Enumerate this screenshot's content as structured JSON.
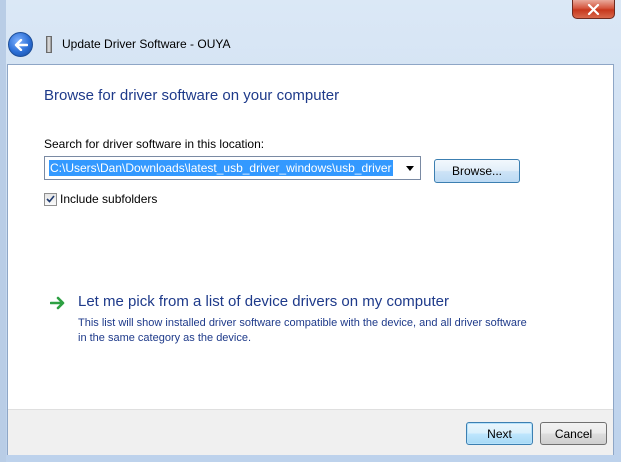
{
  "window": {
    "title": "Update Driver Software - OUYA",
    "close_icon": "close-icon",
    "back_icon": "back-arrow-icon",
    "device_icon": "usb-device-icon"
  },
  "main": {
    "heading": "Browse for driver software on your computer",
    "search_label": "Search for driver software in this location:",
    "path_value": "C:\\Users\\Dan\\Downloads\\latest_usb_driver_windows\\usb_driver",
    "browse_label": "Browse...",
    "include_subfolders_label": "Include subfolders",
    "include_subfolders_checked": true
  },
  "pick": {
    "title": "Let me pick from a list of device drivers on my computer",
    "description": "This list will show installed driver software compatible with the device, and all driver software in the same category as the device.",
    "icon": "green-arrow-icon"
  },
  "footer": {
    "next_label": "Next",
    "cancel_label": "Cancel"
  },
  "colors": {
    "heading": "#1e3a8a",
    "selection": "#3399ff",
    "close_button": "#c7371c"
  }
}
